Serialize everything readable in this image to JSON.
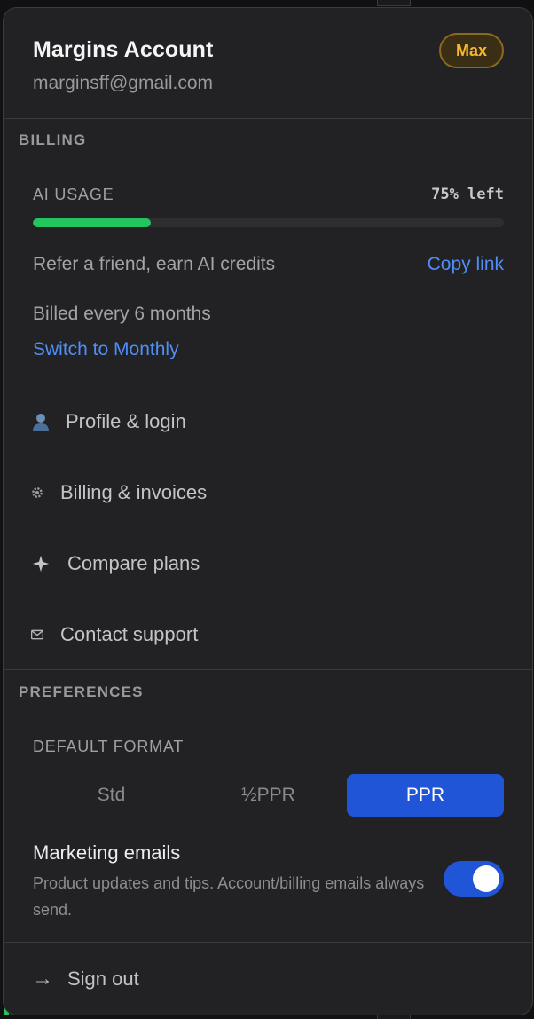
{
  "account": {
    "name": "Margins Account",
    "email": "marginsff@gmail.com",
    "plan_badge": "Max"
  },
  "billing": {
    "section_title": "BILLING",
    "ai_usage_label": "AI USAGE",
    "ai_usage_left": "75% left",
    "ai_usage_used_fraction": 0.25,
    "refer_text": "Refer a friend, earn AI credits",
    "copy_link": "Copy link",
    "billed_text": "Billed every 6 months",
    "switch_link": "Switch to Monthly"
  },
  "menu": [
    {
      "label": "Profile & login",
      "icon": "person-icon"
    },
    {
      "label": "Billing & invoices",
      "icon": "gear-icon"
    },
    {
      "label": "Compare plans",
      "icon": "sparkle-icon"
    },
    {
      "label": "Contact support",
      "icon": "envelope-icon"
    }
  ],
  "preferences": {
    "section_title": "PREFERENCES",
    "format_label": "DEFAULT FORMAT",
    "format_options": [
      "Std",
      "½PPR",
      "PPR"
    ],
    "format_selected": "PPR",
    "marketing_title": "Marketing emails",
    "marketing_desc": "Product updates and tips. Account/billing emails always send.",
    "marketing_enabled": true
  },
  "signout": {
    "label": "Sign out",
    "arrow": "→"
  },
  "colors": {
    "accent_blue": "#1f55d6",
    "link_blue": "#4f8ef7",
    "usage_green": "#22c55e",
    "badge_gold": "#f5b82e"
  }
}
